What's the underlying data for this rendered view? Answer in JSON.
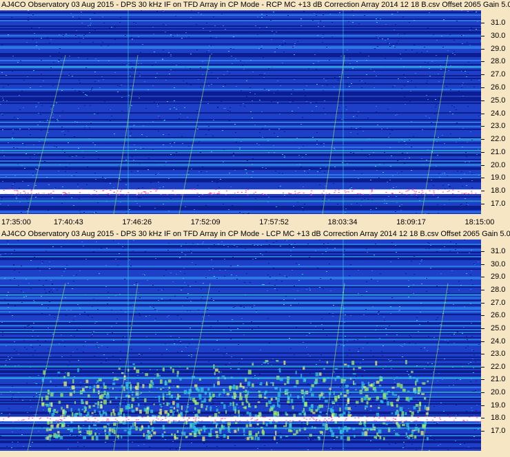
{
  "chart_data": [
    {
      "type": "heatmap",
      "title": "AJ4CO Observatory 03 Aug 2015 - DPS 30 kHz IF on TFD Array in CP Mode - RCP  MC +13 dB  Correction Array 2014 12 18 B.csv  Offset 2065  Gain 5.0",
      "x_tick_labels": [
        "17:35:00",
        "17:40:43",
        "17:46:26",
        "17:52:09",
        "17:57:52",
        "18:03:34",
        "18:09:17",
        "18:15:00"
      ],
      "y_tick_labels": [
        "31.0",
        "30.0",
        "29.0",
        "28.0",
        "27.0",
        "26.0",
        "25.0",
        "24.0",
        "23.0",
        "22.0",
        "21.0",
        "20.0",
        "19.0",
        "18.0",
        "17.0"
      ],
      "x_range": [
        "17:35:00",
        "18:15:00"
      ],
      "ylim": [
        16.5,
        31.8
      ],
      "interference_lines_mhz": [
        17.2,
        17.9,
        18.0,
        20.0,
        21.1,
        22.0,
        27.6
      ],
      "colormap": [
        "#0a1a8a",
        "#1e3fc8",
        "#2c7de6",
        "#30c8e0",
        "#9ef06a",
        "#f0f070",
        "#ff40a0",
        "#ffffff"
      ]
    },
    {
      "type": "heatmap",
      "title": "AJ4CO Observatory 03 Aug 2015 - DPS 30 kHz IF on TFD Array in CP Mode - LCP  MC +13 dB  Correction Array 2014 12 18 B.csv  Offset 2065  Gain 5.0",
      "x_tick_labels": [],
      "y_tick_labels": [
        "31.0",
        "30.0",
        "29.0",
        "28.0",
        "27.0",
        "26.0",
        "25.0",
        "24.0",
        "23.0",
        "22.0",
        "21.0",
        "20.0",
        "19.0",
        "18.0",
        "17.0"
      ],
      "x_range": [
        "17:35:00",
        "18:15:00"
      ],
      "ylim": [
        16.5,
        31.8
      ],
      "interference_lines_mhz": [
        17.2,
        17.9,
        18.0,
        20.0,
        21.1,
        22.0,
        27.6
      ],
      "colormap": [
        "#0a1a8a",
        "#1e3fc8",
        "#2c7de6",
        "#30c8e0",
        "#9ef06a",
        "#f0f070",
        "#ff40a0",
        "#ffffff"
      ]
    }
  ]
}
